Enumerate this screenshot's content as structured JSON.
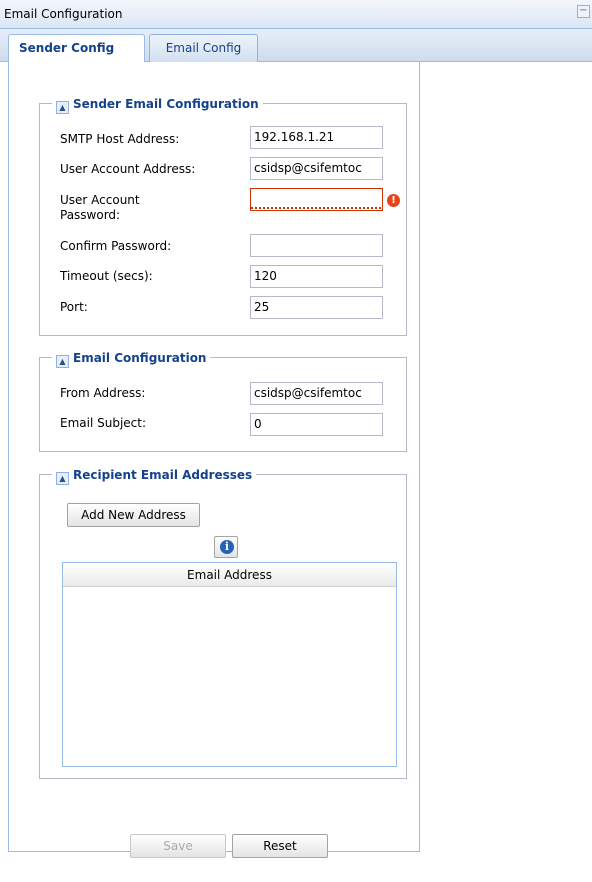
{
  "window": {
    "title": "Email Configuration",
    "collapse_icon": "minus-icon"
  },
  "tabs": [
    {
      "label": "Sender Config",
      "active": true
    },
    {
      "label": "Email Config",
      "active": false
    }
  ],
  "sender_section": {
    "legend": "Sender Email Configuration",
    "fields": {
      "smtp_host": {
        "label": "SMTP Host Address:",
        "value": "192.168.1.21"
      },
      "user_account": {
        "label": "User Account Address:",
        "value": "csidsp@csifemtoc"
      },
      "password": {
        "label_line1": "User Account",
        "label_line2": "Password:",
        "value": ""
      },
      "confirm_password": {
        "label": "Confirm Password:",
        "value": ""
      },
      "timeout": {
        "label": "Timeout (secs):",
        "value": "120"
      },
      "port": {
        "label": "Port:",
        "value": "25"
      }
    }
  },
  "email_section": {
    "legend": "Email Configuration",
    "fields": {
      "from_address": {
        "label": "From Address:",
        "value": "csidsp@csifemtoc"
      },
      "email_subject": {
        "label": "Email Subject:",
        "value": "0"
      }
    }
  },
  "recipient_section": {
    "legend": "Recipient Email Addresses",
    "add_button": "Add New Address",
    "info_icon_glyph": "i",
    "grid": {
      "columns": [
        "Email Address"
      ],
      "rows": []
    }
  },
  "footer": {
    "save_label": "Save",
    "reset_label": "Reset"
  },
  "icons": {
    "error_glyph": "!",
    "toggle_glyph": "▲"
  },
  "colors": {
    "accent": "#15428b",
    "error": "#cc3300",
    "border": "#99bbe8"
  }
}
